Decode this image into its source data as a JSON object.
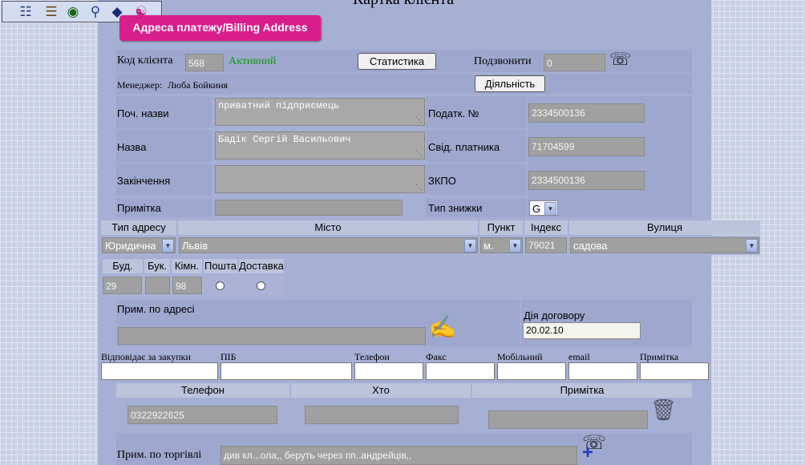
{
  "page": {
    "title": "Картка клієнта",
    "tab_label": "Адреса платежу/Billing Address"
  },
  "toolbar": {
    "icons": [
      "windows-icon",
      "contacts-icon",
      "globe-icon",
      "search-icon",
      "shield-icon",
      "hierarchy-icon"
    ]
  },
  "client": {
    "code_label": "Код клієнта",
    "code_value": "568",
    "status": "Активний",
    "status_color": "#0e9a0e",
    "stats_button": "Статистика",
    "call_label": "Подзвонити",
    "call_value": "0",
    "manager_label": "Менеджер:",
    "manager_name": "Люба Бойкиня",
    "activity_button": "Діяльність"
  },
  "names": {
    "prefix_label": "Поч. назви",
    "prefix_value": "приватний підприємець",
    "name_label": "Назва",
    "name_value": "Бадік Сергій Васильович",
    "suffix_label": "Закінчення",
    "suffix_value": "",
    "note_label": "Примітка",
    "note_value": "",
    "tax_label": "Податк. №",
    "tax_value": "2334500136",
    "cert_label": "Свід. платника",
    "cert_value": "71704599",
    "zkpo_label": "ЗКПО",
    "zkpo_value": "2334500136",
    "discount_label": "Тип знижки",
    "discount_value": "G"
  },
  "address": {
    "headers": {
      "type": "Тип адресу",
      "city": "Місто",
      "point": "Пункт",
      "index": "Індекс",
      "street": "Вулиця"
    },
    "type": "Юридична",
    "city": "Львів",
    "point": "м.",
    "index": "79021",
    "street": "садова",
    "sub_headers": {
      "building": "Буд.",
      "letter": "Бук.",
      "room": "Кімн.",
      "mail": "Пошта",
      "delivery": "Доставка"
    },
    "building": "29",
    "letter": "",
    "room": "98",
    "note_label": "Прим. по адресі",
    "note_value": "",
    "contract_label": "Дія договору",
    "contract_value": "20.02.10"
  },
  "purchase": {
    "headers": [
      "Відповідає за закупки",
      "ПІБ",
      "Телефон",
      "Факс",
      "Мобільний",
      "email",
      "Примітка"
    ],
    "values": [
      "",
      "",
      "",
      "",
      "",
      "",
      ""
    ]
  },
  "phones": {
    "headers": {
      "phone": "Телефон",
      "who": "Хто",
      "note": "Примітка"
    },
    "phone": "0322922625",
    "who": "",
    "note": ""
  },
  "trade": {
    "label": "Прим. по торгівлі",
    "value": "див кл.,.ола,, беруть через пп..андрейців,,"
  }
}
